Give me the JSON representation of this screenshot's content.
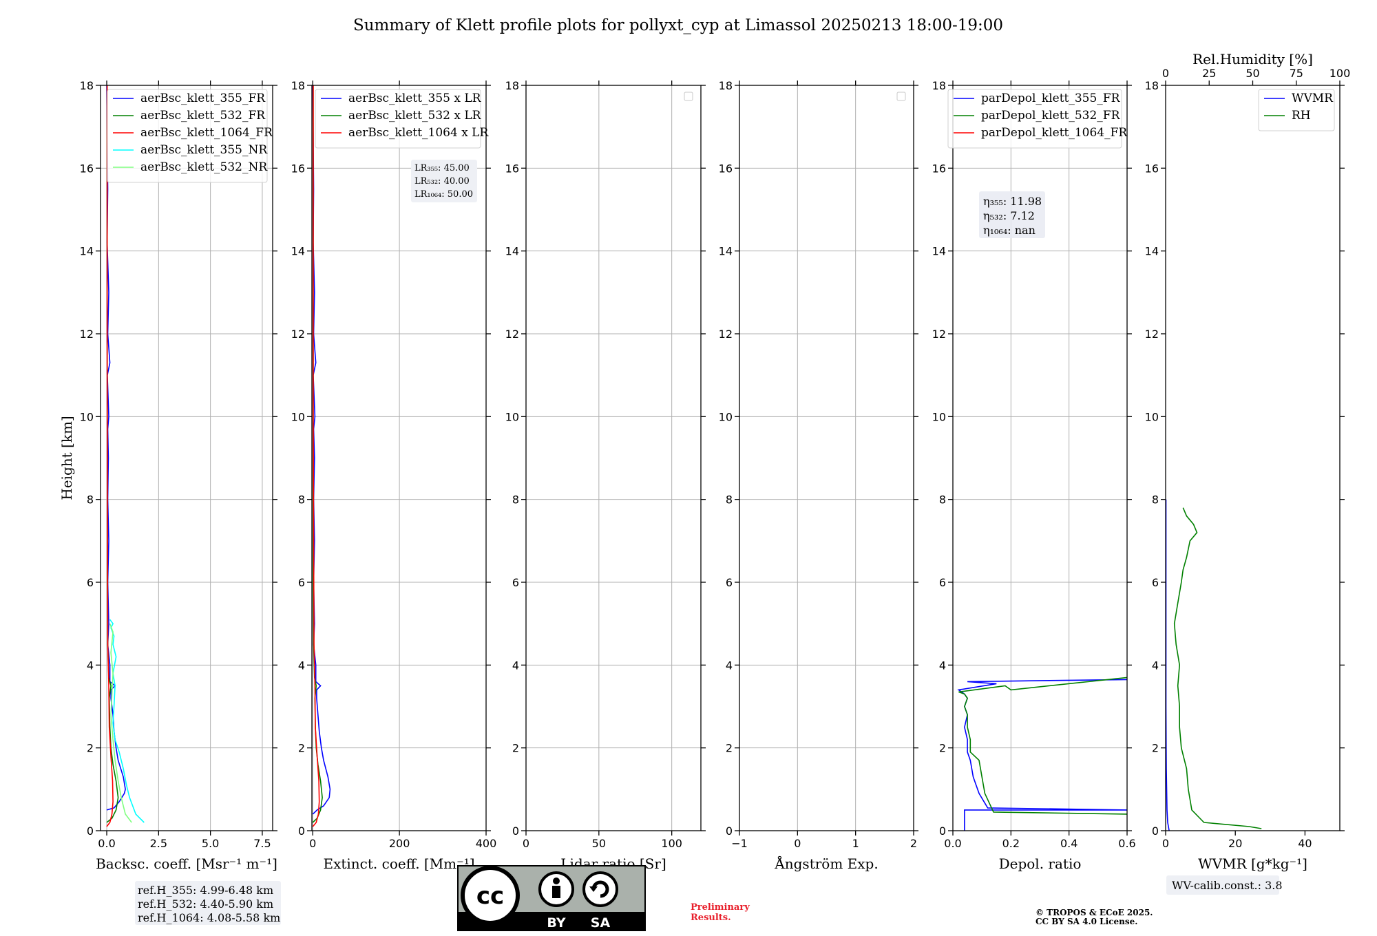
{
  "title": "Summary of Klett profile plots for pollyxt_cyp at Limassol 20250213 18:00-19:00",
  "chart_data": [
    {
      "type": "line",
      "id": "bsc",
      "xlabel": "Backsc. coeff. [Msr⁻¹ m⁻¹]",
      "ylabel": "Height [km]",
      "xlim": [
        -0.3,
        8.0
      ],
      "ylim": [
        0,
        18
      ],
      "xticks": [
        0.0,
        2.5,
        5.0,
        7.5
      ],
      "xticklabels": [
        "0.0",
        "2.5",
        "5.0",
        "7.5"
      ],
      "yticks": [
        0,
        2,
        4,
        6,
        8,
        10,
        12,
        14,
        16,
        18
      ],
      "grid": true,
      "legend": "top-right",
      "series": [
        {
          "name": "aerBsc_klett_355_FR",
          "color": "#0000ff",
          "x": [
            0.0,
            0.35,
            0.6,
            0.85,
            0.9,
            0.8,
            0.55,
            0.45,
            0.35,
            0.3,
            0.2,
            0.2,
            0.4,
            0.15,
            0.15,
            0.05,
            0.1,
            0.05,
            0.1,
            0.05,
            0.08,
            0.05,
            0.1,
            0.03,
            0.15,
            0.05,
            0.1,
            0.02,
            0.05,
            0.0
          ],
          "y": [
            0.5,
            0.55,
            0.7,
            0.9,
            1.0,
            1.3,
            1.7,
            2.0,
            2.4,
            2.8,
            3.2,
            3.4,
            3.5,
            3.6,
            4.0,
            4.5,
            5.0,
            6.0,
            7.0,
            8.0,
            9.0,
            9.7,
            10.0,
            11.0,
            11.3,
            12.0,
            13.0,
            14.2,
            15.5,
            18.0
          ]
        },
        {
          "name": "aerBsc_klett_532_FR",
          "color": "#008000",
          "x": [
            0.0,
            0.25,
            0.45,
            0.55,
            0.45,
            0.3,
            0.2,
            0.15,
            0.12,
            0.2,
            0.1,
            0.05,
            0.03,
            0.03,
            0.02,
            0.02
          ],
          "y": [
            0.2,
            0.3,
            0.5,
            0.8,
            1.2,
            1.6,
            2.0,
            2.5,
            3.2,
            3.5,
            3.7,
            4.5,
            6.0,
            10.0,
            14.0,
            18.0
          ]
        },
        {
          "name": "aerBsc_klett_1064_FR",
          "color": "#ff0000",
          "x": [
            0.0,
            0.15,
            0.25,
            0.3,
            0.28,
            0.2,
            0.12,
            0.1,
            0.05,
            0.03,
            0.02,
            0.02
          ],
          "y": [
            0.1,
            0.2,
            0.4,
            0.7,
            1.2,
            1.8,
            2.5,
            3.5,
            4.5,
            8.0,
            12.0,
            18.0
          ]
        },
        {
          "name": "aerBsc_klett_355_NR",
          "color": "#00ffff",
          "x": [
            1.8,
            1.4,
            1.1,
            0.95,
            0.8,
            0.6,
            0.4,
            0.3,
            0.35,
            0.4,
            0.3,
            0.45,
            0.3,
            0.35,
            0.2,
            0.3,
            0.15
          ],
          "y": [
            0.2,
            0.4,
            0.8,
            1.1,
            1.5,
            1.9,
            2.2,
            2.6,
            3.0,
            3.5,
            3.8,
            4.2,
            4.5,
            4.7,
            4.9,
            5.0,
            5.1
          ]
        },
        {
          "name": "aerBsc_klett_532_NR",
          "color": "#7fff7f",
          "x": [
            1.2,
            0.9,
            0.7,
            0.55,
            0.4,
            0.3,
            0.2,
            0.25,
            0.3,
            0.2,
            0.3,
            0.15
          ],
          "y": [
            0.2,
            0.4,
            0.8,
            1.2,
            1.7,
            2.2,
            2.8,
            3.3,
            3.8,
            4.3,
            4.8,
            5.0
          ]
        }
      ],
      "annotation": [
        "ref.H_355: 4.99-6.48 km",
        "ref.H_532: 4.40-5.90 km",
        "ref.H_1064: 4.08-5.58 km"
      ]
    },
    {
      "type": "line",
      "id": "ext",
      "xlabel": "Extinct. coeff. [Mm⁻¹]",
      "xlim": [
        -2,
        400
      ],
      "ylim": [
        0,
        18
      ],
      "xticks": [
        0,
        200,
        400
      ],
      "xticklabels": [
        "0",
        "200",
        "400"
      ],
      "yticks": [
        0,
        2,
        4,
        6,
        8,
        10,
        12,
        14,
        16,
        18
      ],
      "grid": true,
      "legend": "top-right",
      "series": [
        {
          "name": "aerBsc_klett_355 x LR",
          "color": "#0000ff",
          "x": [
            0,
            10,
            25,
            38,
            40,
            35,
            25,
            20,
            15,
            12,
            9,
            9,
            18,
            7,
            7,
            2,
            4,
            2,
            4,
            2,
            4,
            2,
            5,
            1,
            7,
            2,
            4,
            1,
            2,
            0
          ],
          "y": [
            0.4,
            0.5,
            0.6,
            0.8,
            1.0,
            1.3,
            1.7,
            2.0,
            2.4,
            2.8,
            3.2,
            3.4,
            3.5,
            3.6,
            4.0,
            4.5,
            5.0,
            6.0,
            7.0,
            8.0,
            9.0,
            9.7,
            10.0,
            11.0,
            11.3,
            12.0,
            13.0,
            14.2,
            15.5,
            18.0
          ]
        },
        {
          "name": "aerBsc_klett_532 x LR",
          "color": "#008000",
          "x": [
            0,
            10,
            18,
            22,
            18,
            12,
            8,
            6,
            5,
            8,
            4,
            2,
            1,
            1,
            1
          ],
          "y": [
            0.2,
            0.3,
            0.5,
            0.8,
            1.2,
            1.6,
            2.0,
            2.5,
            3.2,
            3.5,
            3.7,
            4.5,
            6.0,
            12.0,
            18.0
          ]
        },
        {
          "name": "aerBsc_klett_1064 x LR",
          "color": "#ff0000",
          "x": [
            0,
            8,
            13,
            15,
            14,
            10,
            6,
            5,
            3,
            1,
            1
          ],
          "y": [
            0.1,
            0.2,
            0.4,
            0.7,
            1.2,
            1.8,
            2.5,
            3.5,
            4.5,
            10.0,
            18.0
          ]
        }
      ],
      "annotation": [
        "LR₃₅₅: 45.00",
        "LR₅₃₂: 40.00",
        "LR₁₀₆₄: 50.00"
      ]
    },
    {
      "type": "line",
      "id": "lr",
      "xlabel": "Lidar ratio [Sr]",
      "xlim": [
        0,
        120
      ],
      "ylim": [
        0,
        18
      ],
      "xticks": [
        0,
        50,
        100
      ],
      "xticklabels": [
        "0",
        "50",
        "100"
      ],
      "yticks": [
        0,
        2,
        4,
        6,
        8,
        10,
        12,
        14,
        16,
        18
      ],
      "grid": true,
      "series": []
    },
    {
      "type": "line",
      "id": "ang",
      "xlabel": "Ångström Exp.",
      "xlim": [
        -1,
        2
      ],
      "ylim": [
        0,
        18
      ],
      "xticks": [
        -1,
        0,
        1,
        2
      ],
      "xticklabels": [
        "−1",
        "0",
        "1",
        "2"
      ],
      "yticks": [
        0,
        2,
        4,
        6,
        8,
        10,
        12,
        14,
        16,
        18
      ],
      "grid": true,
      "series": []
    },
    {
      "type": "line",
      "id": "depol",
      "xlabel": "Depol. ratio",
      "xlim": [
        0,
        0.6
      ],
      "ylim": [
        0,
        18
      ],
      "xticks": [
        0.0,
        0.2,
        0.4,
        0.6
      ],
      "xticklabels": [
        "0.0",
        "0.2",
        "0.4",
        "0.6"
      ],
      "yticks": [
        0,
        2,
        4,
        6,
        8,
        10,
        12,
        14,
        16,
        18
      ],
      "grid": true,
      "legend": "top-right",
      "series": [
        {
          "name": "parDepol_klett_355_FR",
          "color": "#0000ff",
          "x": [
            0.04,
            0.04,
            0.6,
            0.12,
            0.09,
            0.07,
            0.06,
            0.05,
            0.05,
            0.04,
            0.05,
            0.04,
            0.05,
            0.04,
            0.02,
            0.15,
            0.05,
            0.6
          ],
          "y": [
            0.0,
            0.5,
            0.5,
            0.55,
            0.9,
            1.3,
            1.7,
            1.9,
            2.2,
            2.5,
            2.8,
            3.0,
            3.2,
            3.3,
            3.4,
            3.55,
            3.6,
            3.65
          ]
        },
        {
          "name": "parDepol_klett_532_FR",
          "color": "#008000",
          "x": [
            0.6,
            0.14,
            0.11,
            0.1,
            0.09,
            0.06,
            0.06,
            0.05,
            0.05,
            0.04,
            0.05,
            0.04,
            0.02,
            0.18,
            0.2,
            0.6
          ],
          "y": [
            0.4,
            0.45,
            0.9,
            1.3,
            1.7,
            1.9,
            2.2,
            2.5,
            2.8,
            3.0,
            3.2,
            3.3,
            3.35,
            3.5,
            3.4,
            3.7
          ]
        },
        {
          "name": "parDepol_klett_1064_FR",
          "color": "#ff0000",
          "x": [],
          "y": []
        }
      ],
      "annotation": [
        "η₃₅₅: 11.98",
        "η₅₃₂: 7.12",
        "η₁₀₆₄: nan"
      ]
    },
    {
      "type": "line",
      "id": "wv",
      "xlabel": "WVMR [g*kg⁻¹]",
      "x2label": "Rel.Humidity [%]",
      "xlim": [
        0,
        50
      ],
      "x2lim": [
        0,
        100
      ],
      "ylim": [
        0,
        18
      ],
      "xticks": [
        0,
        20,
        40
      ],
      "xticklabels": [
        "0",
        "20",
        "40"
      ],
      "x2ticks": [
        0,
        25,
        50,
        75,
        100
      ],
      "x2ticklabels": [
        "0",
        "25",
        "50",
        "75",
        "100"
      ],
      "yticks": [
        0,
        2,
        4,
        6,
        8,
        10,
        12,
        14,
        16,
        18
      ],
      "grid": false,
      "legend": "top-right",
      "series": [
        {
          "name": "WVMR",
          "color": "#0000ff",
          "x": [
            1.0,
            0.6,
            0.4,
            0.3,
            0.2,
            0.15,
            0.1,
            0.1,
            0.1
          ],
          "y": [
            0.0,
            0.2,
            0.5,
            1.0,
            1.5,
            2.0,
            3.0,
            5.0,
            8.0
          ]
        },
        {
          "name": "RH",
          "color": "#008000",
          "x2": [
            55,
            48,
            22,
            15,
            13,
            12,
            9,
            8,
            8,
            7,
            8,
            6,
            5,
            7,
            9,
            10,
            12,
            14,
            18,
            16,
            12,
            10
          ],
          "y": [
            0.05,
            0.1,
            0.2,
            0.5,
            1.0,
            1.5,
            2.0,
            2.5,
            3.0,
            3.5,
            4.0,
            4.5,
            5.0,
            5.5,
            6.0,
            6.3,
            6.6,
            7.0,
            7.2,
            7.4,
            7.6,
            7.8
          ]
        }
      ],
      "annotation": [
        "WV-calib.const.: 3.8"
      ]
    }
  ],
  "license": {
    "by_label": "BY",
    "sa_label": "SA",
    "cc_label": "cc"
  },
  "preliminary": [
    "Preliminary",
    "Results."
  ],
  "copyright": [
    "© TROPOS & ECoE 2025.",
    "CC BY SA 4.0 License."
  ]
}
